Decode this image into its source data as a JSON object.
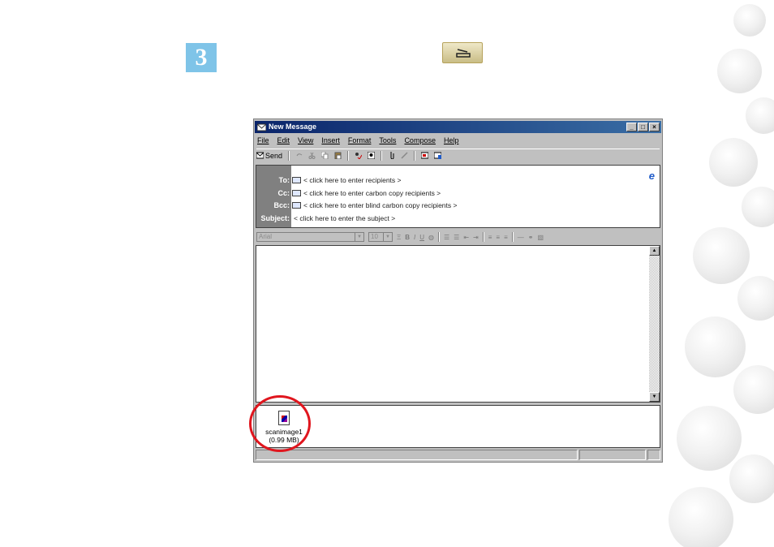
{
  "step": {
    "number": "3"
  },
  "window": {
    "title": "New Message",
    "controls": {
      "minimize": "_",
      "maximize": "□",
      "close": "×"
    },
    "menu": [
      "File",
      "Edit",
      "View",
      "Insert",
      "Format",
      "Tools",
      "Compose",
      "Help"
    ],
    "toolbar": {
      "send_label": "Send"
    },
    "header": {
      "to_label": "To:",
      "to_value": "< click here to enter recipients >",
      "cc_label": "Cc:",
      "cc_value": "< click here to enter carbon copy recipients >",
      "bcc_label": "Bcc:",
      "bcc_value": "< click here to enter blind carbon copy recipients >",
      "subject_label": "Subject:",
      "subject_value": "< click here to enter the subject >"
    },
    "format": {
      "font": "Arial",
      "size": "10"
    },
    "attachment": {
      "name": "scanimage1",
      "size": "(0.99 MB)"
    }
  },
  "colors": {
    "step_badge": "#7fc4e8",
    "title_bar": "#0a246a",
    "highlight_circle": "#e0161e"
  }
}
